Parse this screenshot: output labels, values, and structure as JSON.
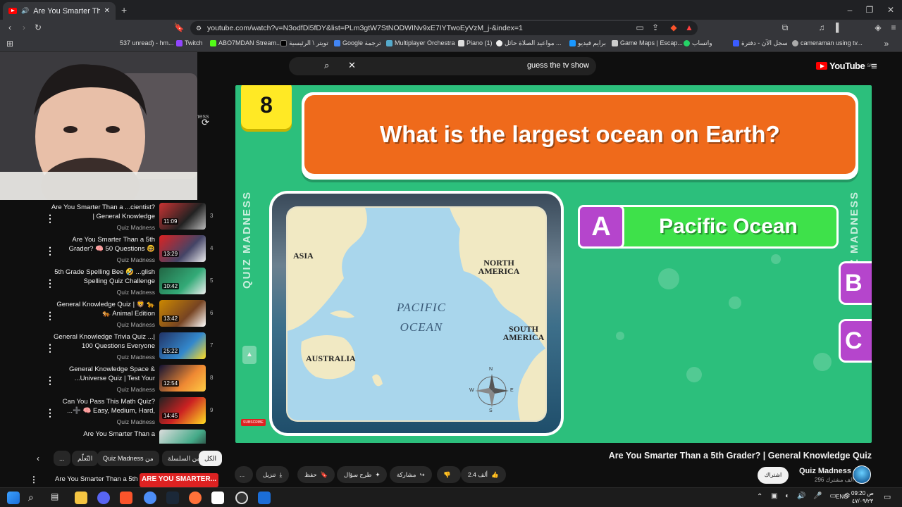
{
  "browser": {
    "tab_title": "Are You Smarter Than a 5th G...",
    "new_tab": "+",
    "url": "youtube.com/watch?v=N3odfDl5fDY&list=PLm3gtW7StNODWINv9xE7IYTwoEyVzM_j-&index=1",
    "window_controls": [
      "–",
      "❐",
      "✕"
    ]
  },
  "bookmarks": [
    "537 unread) - hm...",
    "Twitch",
    "ABO7MDAN Stream...",
    "تويتر \\ الرئيسية",
    "Google ترجمة",
    "Multiplayer Orchestra",
    "Piano (1)",
    "مواعيد الصلاة حائل ...",
    "برايم فيديو",
    "Game Maps | Escap...",
    "واتساب",
    "سجل الآن - دفترة",
    "cameraman using tv..."
  ],
  "youtube": {
    "search_query": "guess the tv show",
    "logo_text": "YouTube",
    "logo_region": "SA"
  },
  "playlist": {
    "header_channel": "Quiz Madness",
    "items": [
      {
        "title": "Are You Smarter Than a ...cientist? | General Knowledge",
        "channel": "Quiz Madness",
        "duration": "11:09",
        "index": "3",
        "thumb_text": "ARE YOU SMARTER"
      },
      {
        "title": "Are You Smarter Than a 5th Grader? 🧠 50 Questions 🤓",
        "channel": "Quiz Madness",
        "duration": "13:29",
        "index": "4",
        "thumb_text": "ARE YOU SMARTER"
      },
      {
        "title": "5th Grade Spelling Bee 🤣 ...glish Spelling Quiz Challenge",
        "channel": "Quiz Madness",
        "duration": "10:42",
        "index": "5",
        "thumb_text": "CAN YOU PASS 5TH GRADE SPELLING?"
      },
      {
        "title": "General Knowledge Quiz | 🦁 🐆 🐅 Animal Edition",
        "channel": "Quiz Madness",
        "duration": "13:42",
        "index": "6",
        "thumb_text": "Fastest Animal is..."
      },
      {
        "title": "General Knowledge Trivia Quiz ...| 100 Questions Everyone",
        "channel": "Quiz Madness",
        "duration": "25:22",
        "index": "7",
        "thumb_text": "GENERAL KNOWLEDGE 100"
      },
      {
        "title": "General Knowledge Space & ...Universe Quiz | Test Your",
        "channel": "Quiz Madness",
        "duration": "12:54",
        "index": "8",
        "thumb_text": "WHICH ONE BIGGER?"
      },
      {
        "title": "Can You Pass This Math Quiz? ...➕ 🧠 Easy, Medium, Hard,",
        "channel": "Quiz Madness",
        "duration": "14:45",
        "index": "9",
        "thumb_text": "CAN YOU SOLVE THIS? 9 × 8 ="
      },
      {
        "title": "Are You Smarter Than a",
        "channel": "",
        "duration": "",
        "index": "",
        "thumb_text": "Emma: Means?"
      }
    ],
    "chips": [
      "الكل",
      "من السلسلة",
      "Quiz Madness من",
      "التّعلّم",
      "..."
    ],
    "bottom_item": "Are You Smarter Than a 5th",
    "bottom_thumb": "ARE YOU SMARTER..."
  },
  "quiz": {
    "number": "8",
    "question": "What is the largest ocean on Earth?",
    "answer_letter": "A",
    "answer_text": "Pacific Ocean",
    "side_letters": [
      "B",
      "C"
    ],
    "watermark": "QUIZ MADNESS",
    "map": {
      "labels": [
        "ASIA",
        "NORTH AMERICA",
        "AUSTRALIA",
        "SOUTH AMERICA"
      ],
      "ocean_line1": "PACIFIC",
      "ocean_line2": "OCEAN",
      "compass": [
        "N",
        "E",
        "S",
        "W"
      ]
    },
    "subscribe_badge": "SUBSCRIBE"
  },
  "video_meta": {
    "title": "Are You Smarter Than a 5th Grader? | General Knowledge Quiz",
    "channel": "Quiz Madness",
    "subscribers": "296 ألف مشترك",
    "subscribe_label": "اشتراك",
    "like_count": "2.4 ألف",
    "share_label": "مشاركة",
    "ask_label": "طرح سؤال",
    "save_label": "حفظ",
    "download_label": "تنزيل",
    "more_label": "..."
  },
  "taskbar": {
    "time": "09:20 ص",
    "date": "٤٧/٠٩/٢٣",
    "lang": "ENG"
  },
  "colors": {
    "video_bg": "#2cbf7c",
    "question_bg": "#ef6a1b",
    "answer_green": "#3ee14a",
    "letter_purple": "#b545cc",
    "number_yellow": "#ffe925",
    "yt_red": "#ff0000"
  }
}
